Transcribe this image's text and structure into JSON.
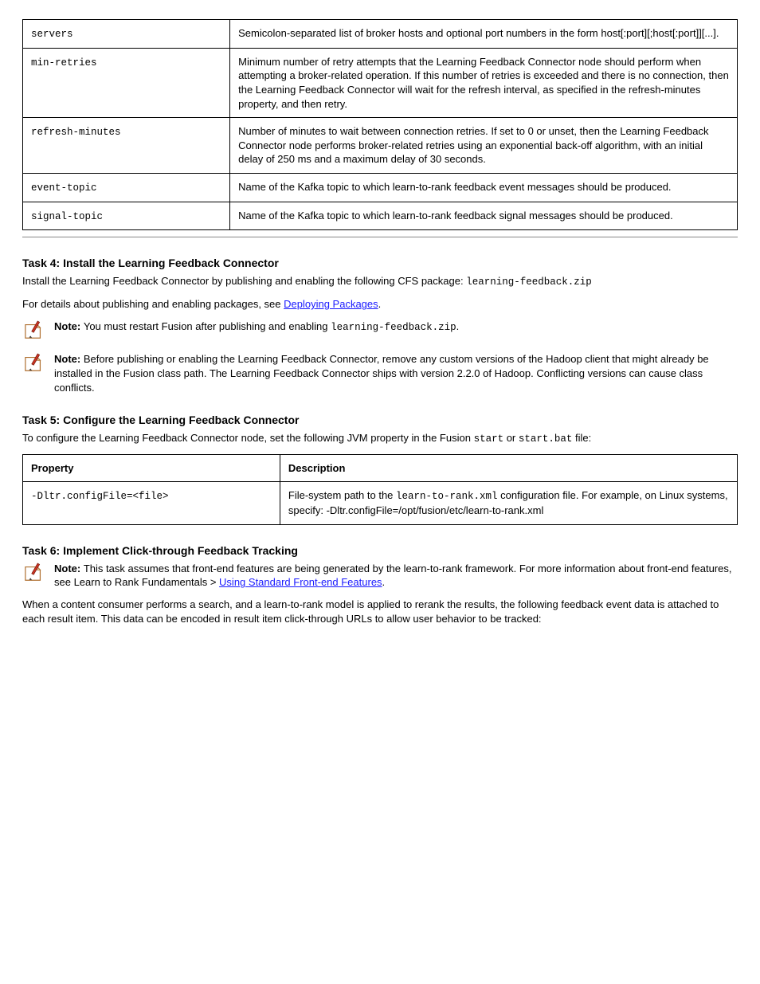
{
  "table1": {
    "rows": [
      {
        "prop": "servers",
        "desc": "Semicolon-separated list of broker hosts and optional port numbers in the form host[:port][;host[:port]][...]."
      },
      {
        "prop": "min-retries",
        "desc": "Minimum number of retry attempts that the Learning Feedback Connector node should perform when attempting a broker-related operation. If this number of retries is exceeded and there is no connection, then the Learning Feedback Connector will wait for the refresh interval, as specified in the refresh-minutes property, and then retry."
      },
      {
        "prop": "refresh-minutes",
        "desc": "Number of minutes to wait between connection retries. If set to 0 or unset, then the Learning Feedback Connector node performs broker-related retries using an exponential back-off algorithm, with an initial delay of 250 ms and a maximum delay of 30 seconds."
      },
      {
        "prop": "event-topic",
        "desc": "Name of the Kafka topic to which learn-to-rank feedback event messages should be produced."
      },
      {
        "prop": "signal-topic",
        "desc": "Name of the Kafka topic to which learn-to-rank feedback signal messages should be produced."
      }
    ]
  },
  "section1": {
    "heading": "Task 4: Install the Learning Feedback Connector",
    "para1_pre": "Install the Learning Feedback Connector by publishing and enabling the following CFS package: ",
    "pkg": "learning-feedback.zip",
    "para2_pre": "For details about publishing and enabling packages, see ",
    "link": "Deploying Packages",
    "para2_post": "."
  },
  "notes1": [
    {
      "text_pre": "You must restart Fusion after publishing and enabling ",
      "code": "learning-feedback.zip",
      "text_post": "."
    },
    {
      "text": "Before publishing or enabling the Learning Feedback Connector, remove any custom versions of the Hadoop client that might already be installed in the Fusion class path. The Learning Feedback Connector ships with version 2.2.0 of Hadoop. Conflicting versions can cause class conflicts."
    }
  ],
  "section2": {
    "heading": "Task 5: Configure the Learning Feedback Connector",
    "para_pre": "To configure the Learning Feedback Connector node, set the following JVM property in the Fusion ",
    "code1": "start",
    "mid": " or ",
    "code2": "start.bat",
    "para_post": " file:"
  },
  "table2": {
    "headers": {
      "prop": "Property",
      "desc": "Description"
    },
    "rows": [
      {
        "prop": "-Dltr.configFile=<file>",
        "desc_pre": "File-system path to the ",
        "code": "learn-to-rank.xml",
        "desc_post": " configuration file. For example, on Linux systems, specify: -Dltr.configFile=/opt/fusion/etc/learn-to-rank.xml"
      }
    ]
  },
  "section3": {
    "heading": "Task 6: Implement Click-through Feedback Tracking"
  },
  "note3": {
    "text": "This task assumes that front-end features are being generated by the learn-to-rank framework. For more information about front-end features, see Learn to Rank Fundamentals > ",
    "link": "Using Standard Front-end Features"
  },
  "trailing": {
    "para": "When a content consumer performs a search, and a learn-to-rank model is applied to rerank the results, the following feedback event data is attached to each result item. This data can be encoded in result item click-through URLs to allow user behavior to be tracked:"
  }
}
